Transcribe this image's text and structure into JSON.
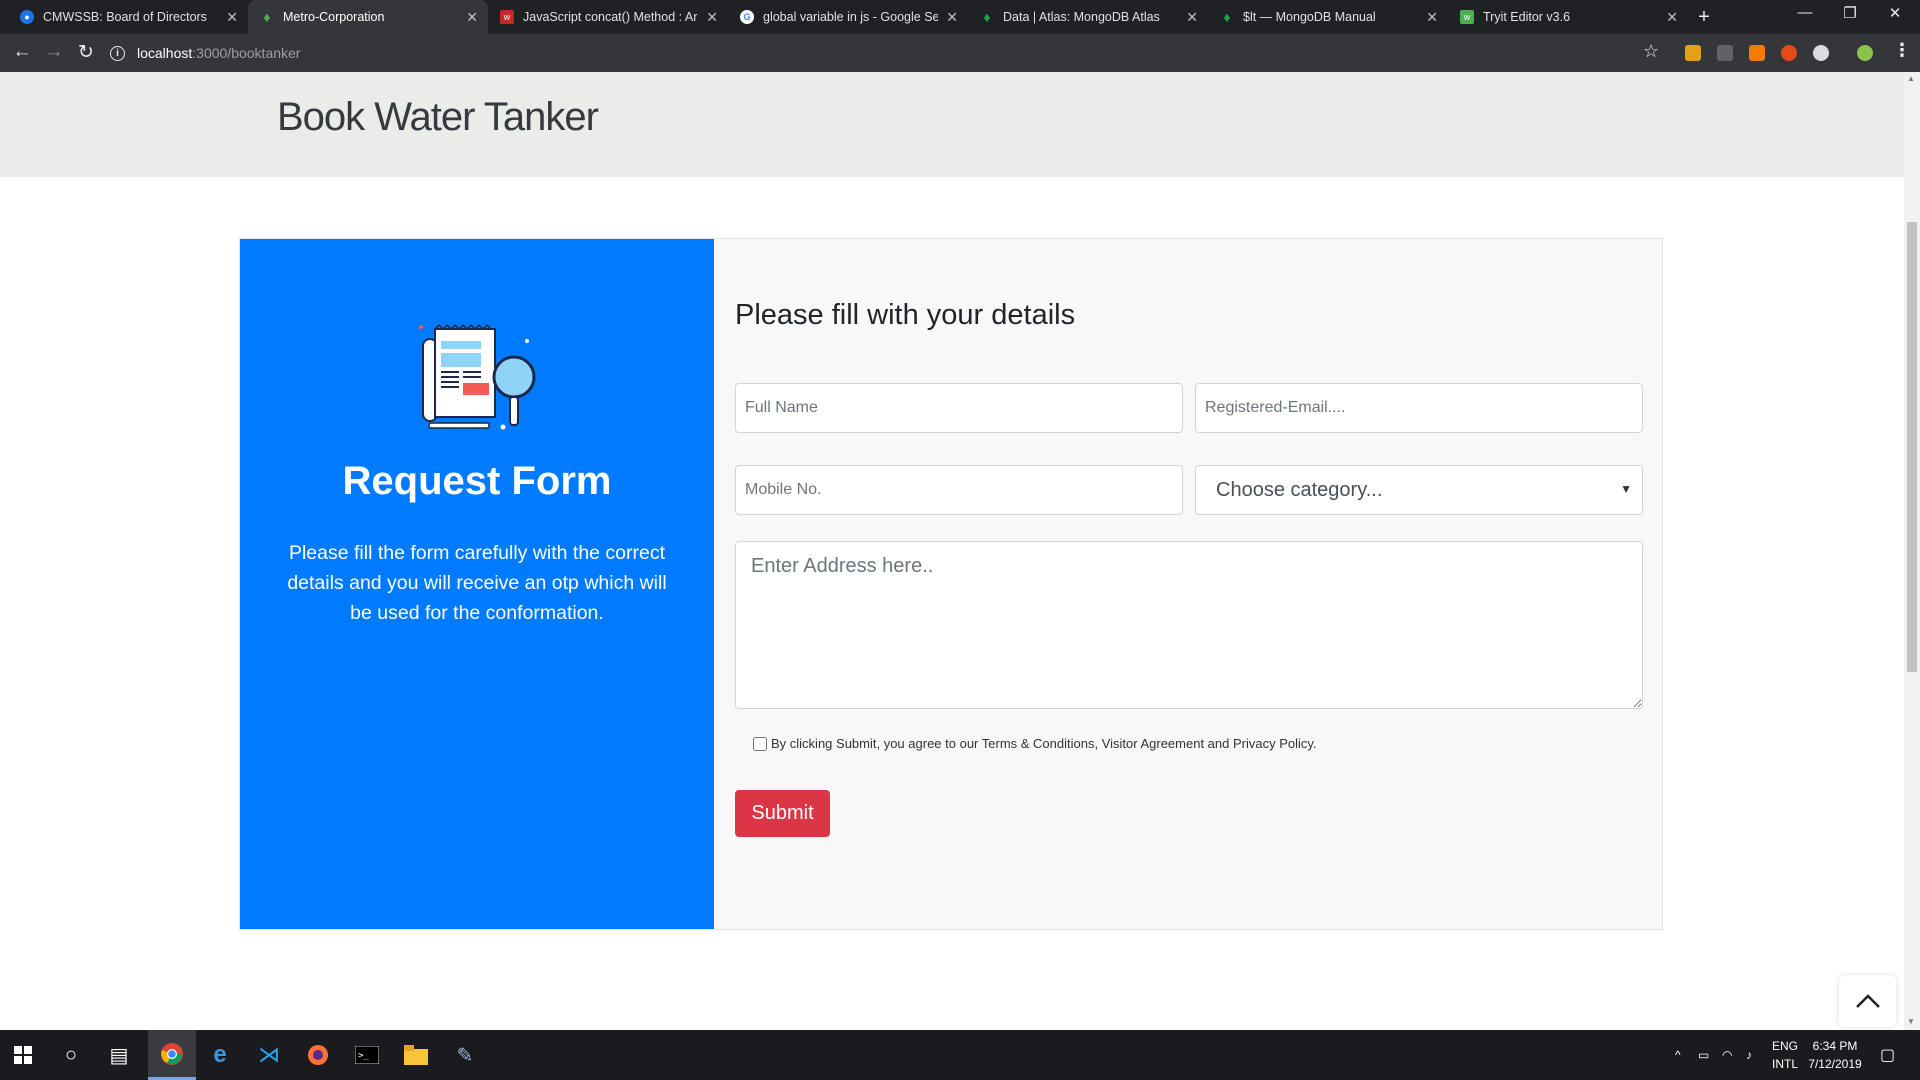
{
  "browser": {
    "tabs": [
      {
        "title": "CMWSSB: Board of Directors",
        "icon": "globe-icon",
        "color": "#1a73e8",
        "active": false
      },
      {
        "title": "Metro-Corporation",
        "icon": "leaf-icon",
        "color": "#4caf50",
        "active": true
      },
      {
        "title": "JavaScript concat() Method : Arra",
        "icon": "w3-icon",
        "color": "#c62828",
        "active": false
      },
      {
        "title": "global variable in js - Google Sea",
        "icon": "google-icon",
        "color": "#4285f4",
        "active": false
      },
      {
        "title": "Data | Atlas: MongoDB Atlas",
        "icon": "leaf-icon",
        "color": "#13aa52",
        "active": false
      },
      {
        "title": "$lt — MongoDB Manual",
        "icon": "leaf-icon",
        "color": "#13aa52",
        "active": false
      },
      {
        "title": "Tryit Editor v3.6",
        "icon": "w3-icon",
        "color": "#4caf50",
        "active": false
      }
    ],
    "url_host": "localhost",
    "url_path": ":3000/booktanker"
  },
  "page": {
    "header_title": "Book Water Tanker",
    "left_panel": {
      "title": "Request Form",
      "description": "Please fill the form carefully with the correct details and you will receive an otp which will be used for the conformation."
    },
    "form": {
      "title": "Please fill with your details",
      "full_name_placeholder": "Full Name",
      "email_placeholder": "Registered-Email....",
      "mobile_placeholder": "Mobile No.",
      "category_selected": "Choose category...",
      "address_placeholder": "Enter Address here..",
      "terms_text": "By clicking Submit, you agree to our Terms & Conditions, Visitor Agreement and Privacy Policy.",
      "terms_checked": false,
      "submit_label": "Submit"
    }
  },
  "taskbar": {
    "language": "ENG",
    "layout": "INTL",
    "time": "6:34 PM",
    "date": "7/12/2019"
  },
  "colors": {
    "panel_blue": "#007bff",
    "submit_red": "#dc3545"
  }
}
